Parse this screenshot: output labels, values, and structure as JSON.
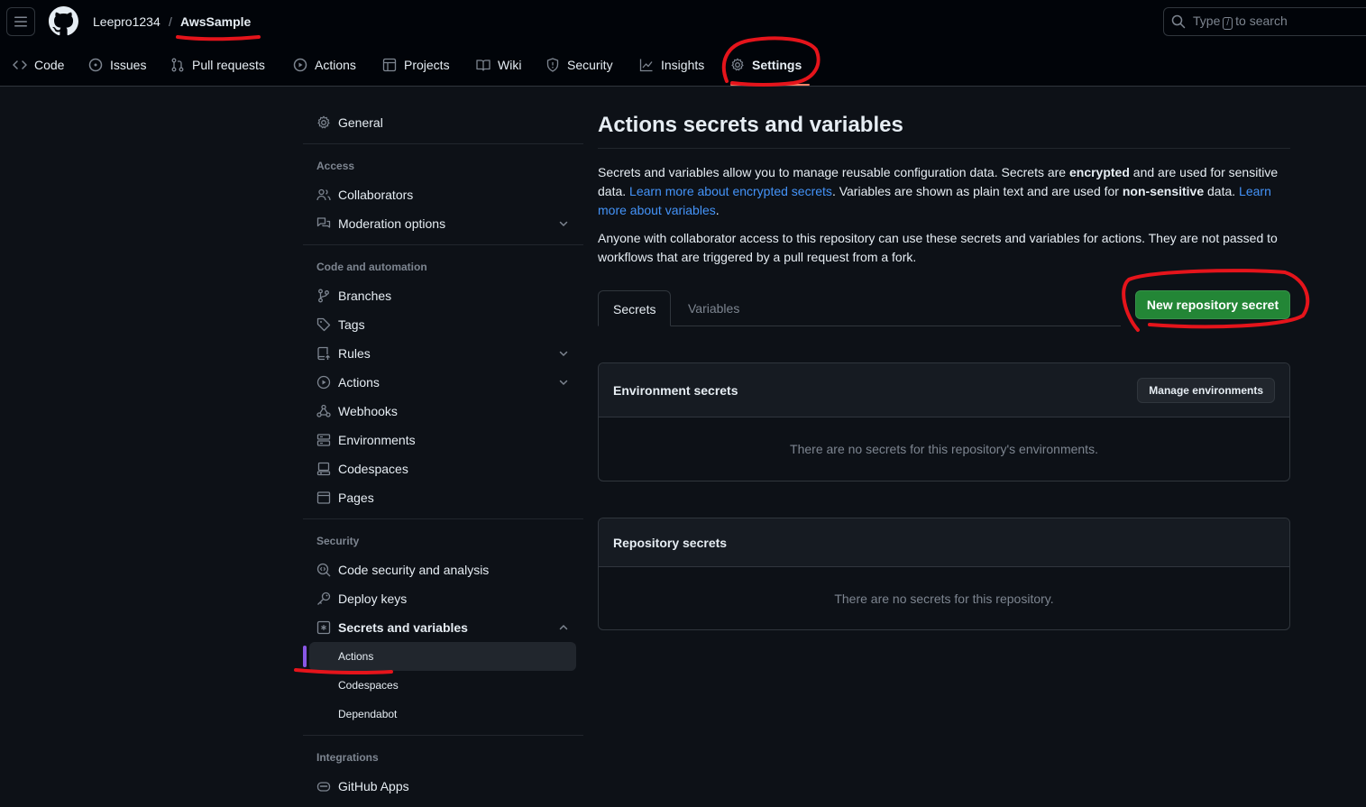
{
  "header": {
    "owner": "Leepro1234",
    "separator": "/",
    "repo": "AwsSample",
    "search": {
      "prefix": "Type",
      "key": "/",
      "suffix": "to search"
    },
    "icons": {
      "menu": "hamburger-icon",
      "logo": "github-mark-icon",
      "search": "search-icon"
    }
  },
  "repo_nav": [
    {
      "label": "Code",
      "icon": "code-icon"
    },
    {
      "label": "Issues",
      "icon": "issue-opened-icon"
    },
    {
      "label": "Pull requests",
      "icon": "git-pull-request-icon"
    },
    {
      "label": "Actions",
      "icon": "play-icon"
    },
    {
      "label": "Projects",
      "icon": "table-icon"
    },
    {
      "label": "Wiki",
      "icon": "book-icon"
    },
    {
      "label": "Security",
      "icon": "shield-icon"
    },
    {
      "label": "Insights",
      "icon": "graph-icon"
    },
    {
      "label": "Settings",
      "icon": "gear-icon",
      "active": true
    }
  ],
  "sidebar": {
    "general": "General",
    "sections": {
      "access": "Access",
      "code_automation": "Code and automation",
      "security": "Security",
      "integrations": "Integrations"
    },
    "items": {
      "collaborators": "Collaborators",
      "moderation": "Moderation options",
      "branches": "Branches",
      "tags": "Tags",
      "rules": "Rules",
      "actions": "Actions",
      "webhooks": "Webhooks",
      "environments": "Environments",
      "codespaces": "Codespaces",
      "pages": "Pages",
      "code_security": "Code security and analysis",
      "deploy_keys": "Deploy keys",
      "secrets_variables": "Secrets and variables",
      "sv_actions": "Actions",
      "sv_codespaces": "Codespaces",
      "sv_dependabot": "Dependabot",
      "github_apps": "GitHub Apps"
    },
    "selected": "sv_actions"
  },
  "main": {
    "title": "Actions secrets and variables",
    "intro": {
      "p1": "Secrets and variables allow you to manage reusable configuration data. Secrets are ",
      "p1_bold": "encrypted",
      "p2": " and are used for sensitive data. ",
      "link1": "Learn more about encrypted secrets",
      "p3": ". Variables are shown as plain text and are used for ",
      "p3_bold": "non-sensitive",
      "p4": " data. ",
      "link2": "Learn more about variables",
      "p5": "."
    },
    "notice": "Anyone with collaborator access to this repository can use these secrets and variables for actions. They are not passed to workflows that are triggered by a pull request from a fork.",
    "tabs": [
      {
        "label": "Secrets",
        "selected": true
      },
      {
        "label": "Variables",
        "selected": false
      }
    ],
    "new_secret_button": "New repository secret",
    "environment_secrets": {
      "title": "Environment secrets",
      "button": "Manage environments",
      "empty": "There are no secrets for this repository's environments."
    },
    "repository_secrets": {
      "title": "Repository secrets",
      "empty": "There are no secrets for this repository."
    }
  },
  "colors": {
    "background": "#0d1117",
    "header": "#010409",
    "primary_button": "#238636",
    "link": "#4493f8",
    "annotation": "#e5141b",
    "selected_marker": "#8957e5"
  }
}
